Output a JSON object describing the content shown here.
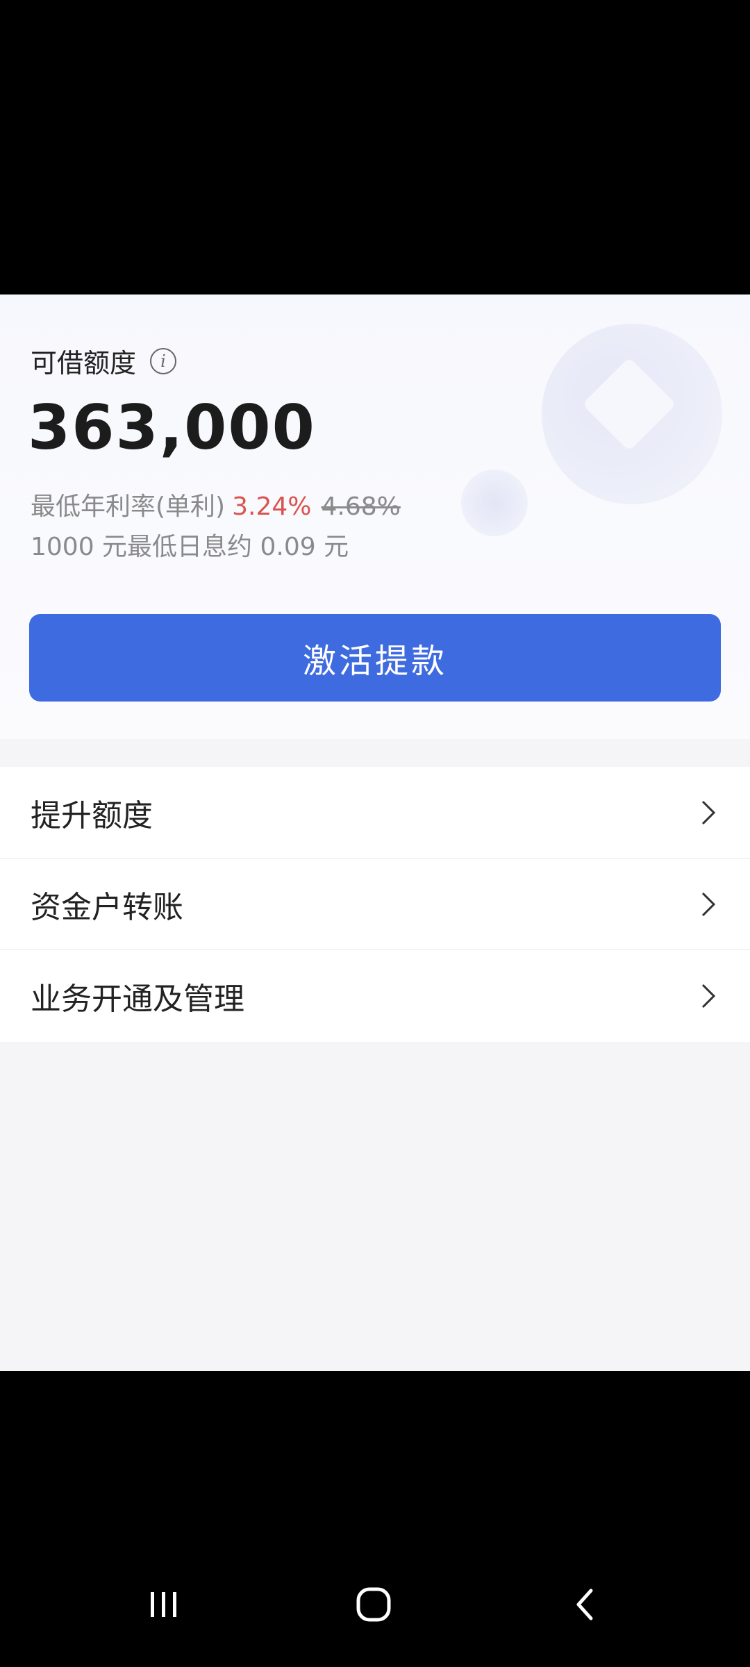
{
  "loan": {
    "label": "可借额度",
    "amount": "363,000",
    "rate_prefix": "最低年利率(单利)",
    "rate_now": "3.24%",
    "rate_old": "4.68%",
    "daily": "1000 元最低日息约 0.09 元",
    "cta": "激活提款"
  },
  "menu": [
    {
      "label": "提升额度"
    },
    {
      "label": "资金户转账"
    },
    {
      "label": "业务开通及管理"
    }
  ],
  "colors": {
    "accent": "#3f6be0",
    "rate_highlight": "#d9534f"
  },
  "icons": {
    "info": "info-icon",
    "chevron": "chevron-right-icon",
    "nav_recents": "recents-icon",
    "nav_home": "home-icon",
    "nav_back": "back-icon"
  }
}
